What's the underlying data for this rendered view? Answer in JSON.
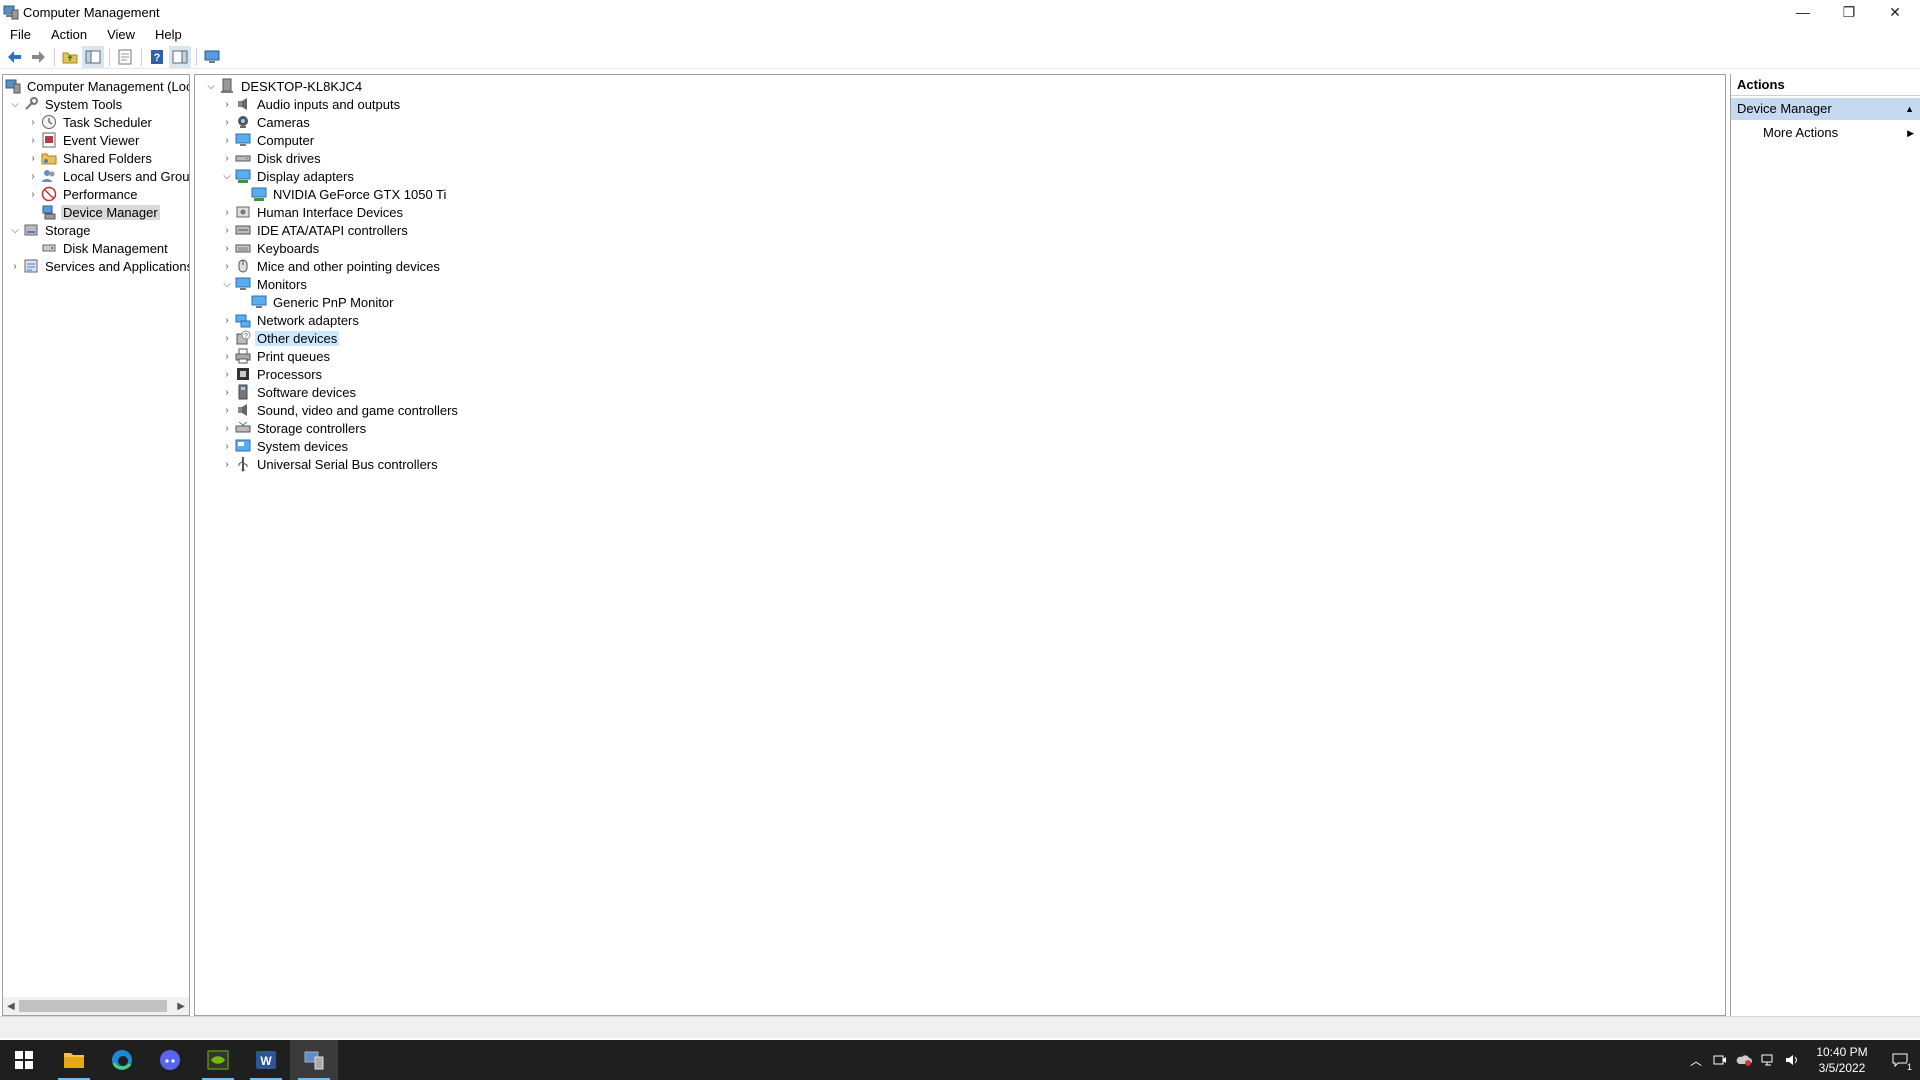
{
  "window": {
    "title": "Computer Management",
    "minimize_glyph": "—",
    "restore_glyph": "❐",
    "close_glyph": "✕"
  },
  "menubar": {
    "file": "File",
    "action": "Action",
    "view": "View",
    "help": "Help"
  },
  "left_tree": {
    "root": "Computer Management (Local",
    "system_tools": "System Tools",
    "task_scheduler": "Task Scheduler",
    "event_viewer": "Event Viewer",
    "shared_folders": "Shared Folders",
    "local_users_groups": "Local Users and Groups",
    "performance": "Performance",
    "device_manager": "Device Manager",
    "storage": "Storage",
    "disk_management": "Disk Management",
    "services_apps": "Services and Applications"
  },
  "device_tree": {
    "computer": "DESKTOP-KL8KJC4",
    "items": [
      {
        "label": "Audio inputs and outputs",
        "icon": "speaker-icon"
      },
      {
        "label": "Cameras",
        "icon": "camera-icon"
      },
      {
        "label": "Computer",
        "icon": "monitor-icon"
      },
      {
        "label": "Disk drives",
        "icon": "disk-drive-icon"
      },
      {
        "label": "Display adapters",
        "icon": "display-adapter-icon",
        "expanded": true,
        "children": [
          "NVIDIA GeForce GTX 1050 Ti"
        ]
      },
      {
        "label": "Human Interface Devices",
        "icon": "hid-icon"
      },
      {
        "label": "IDE ATA/ATAPI controllers",
        "icon": "ide-controller-icon"
      },
      {
        "label": "Keyboards",
        "icon": "keyboard-icon"
      },
      {
        "label": "Mice and other pointing devices",
        "icon": "mouse-icon"
      },
      {
        "label": "Monitors",
        "icon": "monitor-icon",
        "expanded": true,
        "children": [
          "Generic PnP Monitor"
        ]
      },
      {
        "label": "Network adapters",
        "icon": "network-adapter-icon"
      },
      {
        "label": "Other devices",
        "icon": "unknown-device-icon",
        "selected": true
      },
      {
        "label": "Print queues",
        "icon": "printer-icon"
      },
      {
        "label": "Processors",
        "icon": "processor-icon"
      },
      {
        "label": "Software devices",
        "icon": "software-device-icon"
      },
      {
        "label": "Sound, video and game controllers",
        "icon": "sound-icon"
      },
      {
        "label": "Storage controllers",
        "icon": "storage-controller-icon"
      },
      {
        "label": "System devices",
        "icon": "system-device-icon"
      },
      {
        "label": "Universal Serial Bus controllers",
        "icon": "usb-icon"
      }
    ]
  },
  "actions": {
    "title": "Actions",
    "section": "Device Manager",
    "more_actions": "More Actions"
  },
  "taskbar": {
    "time": "10:40 PM",
    "date": "3/5/2022",
    "notification_count": "1",
    "apps": [
      "start-icon",
      "file-explorer-icon",
      "edge-icon",
      "discord-icon",
      "nvidia-icon",
      "word-icon",
      "computer-management-icon"
    ]
  },
  "colors": {
    "selection": "#cce8ff",
    "actions_header": "#c5d9f1",
    "taskbar": "#1f1f1f",
    "accent": "#0078d7"
  }
}
